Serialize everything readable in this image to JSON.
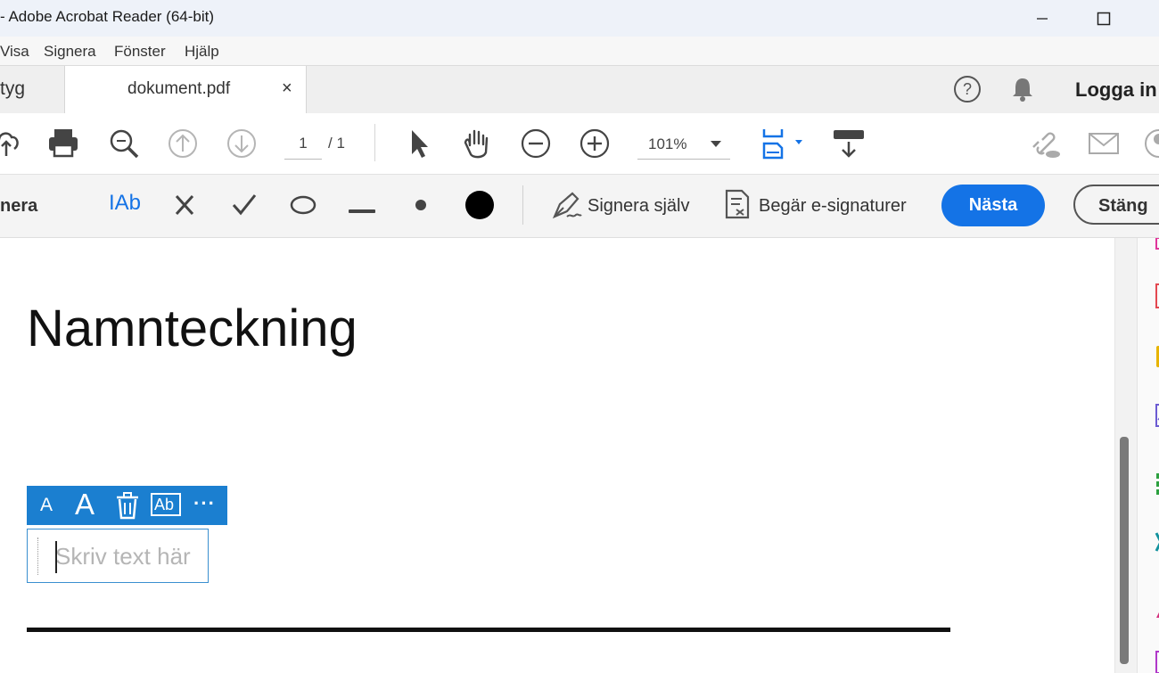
{
  "window": {
    "title": "- Adobe Acrobat Reader (64-bit)",
    "controls": [
      "minimize",
      "maximize"
    ]
  },
  "menu": {
    "items": [
      "Visa",
      "Signera",
      "Fönster",
      "Hjälp"
    ]
  },
  "tabs": {
    "previous_label": "tyg",
    "active_label": "dokument.pdf",
    "close_glyph": "×",
    "login_label": "Logga in"
  },
  "toolbar": {
    "page_current": "1",
    "page_total": "/ 1",
    "zoom": "101%",
    "icons": [
      "upload-icon",
      "print-icon",
      "zoom-search-icon",
      "page-up-icon",
      "page-down-icon",
      "select-arrow-icon",
      "hand-icon",
      "zoom-out-icon",
      "zoom-in-icon",
      "fit-page-icon",
      "scroll-mode-icon",
      "link-icon",
      "email-icon",
      "account-icon"
    ]
  },
  "signbar": {
    "section_label": "nera",
    "text_tool": "IAb",
    "sign_self_label": "Signera själv",
    "request_label": "Begär e-signaturer",
    "next_label": "Nästa",
    "close_label": "Stäng",
    "accent_color": "#1473e6"
  },
  "document": {
    "heading": "Namnteckning",
    "textfield_placeholder": "Skriv text här",
    "mini_toolbar": {
      "small_a": "A",
      "large_a": "A",
      "ab": "Ab",
      "more": "···"
    }
  }
}
